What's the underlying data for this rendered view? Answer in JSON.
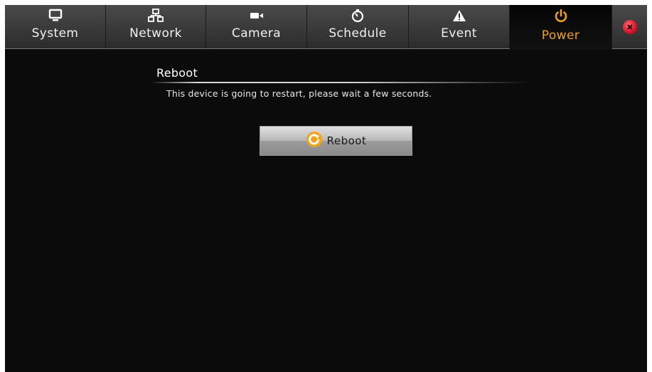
{
  "tabs": [
    {
      "label": "System",
      "icon": "monitor-icon"
    },
    {
      "label": "Network",
      "icon": "network-icon"
    },
    {
      "label": "Camera",
      "icon": "camera-icon"
    },
    {
      "label": "Schedule",
      "icon": "stopwatch-icon"
    },
    {
      "label": "Event",
      "icon": "warning-icon"
    },
    {
      "label": "Power",
      "icon": "power-icon",
      "active": true
    }
  ],
  "close": {
    "icon": "close-icon",
    "color": "#e0102a"
  },
  "section": {
    "title": "Reboot",
    "message": "This device is going to restart, please wait a few seconds."
  },
  "reboot_button": {
    "label": "Reboot",
    "icon": "refresh-icon"
  },
  "colors": {
    "accent": "#f0a020",
    "background": "#0b0b0b",
    "tabbar": "#3a3a3a"
  }
}
